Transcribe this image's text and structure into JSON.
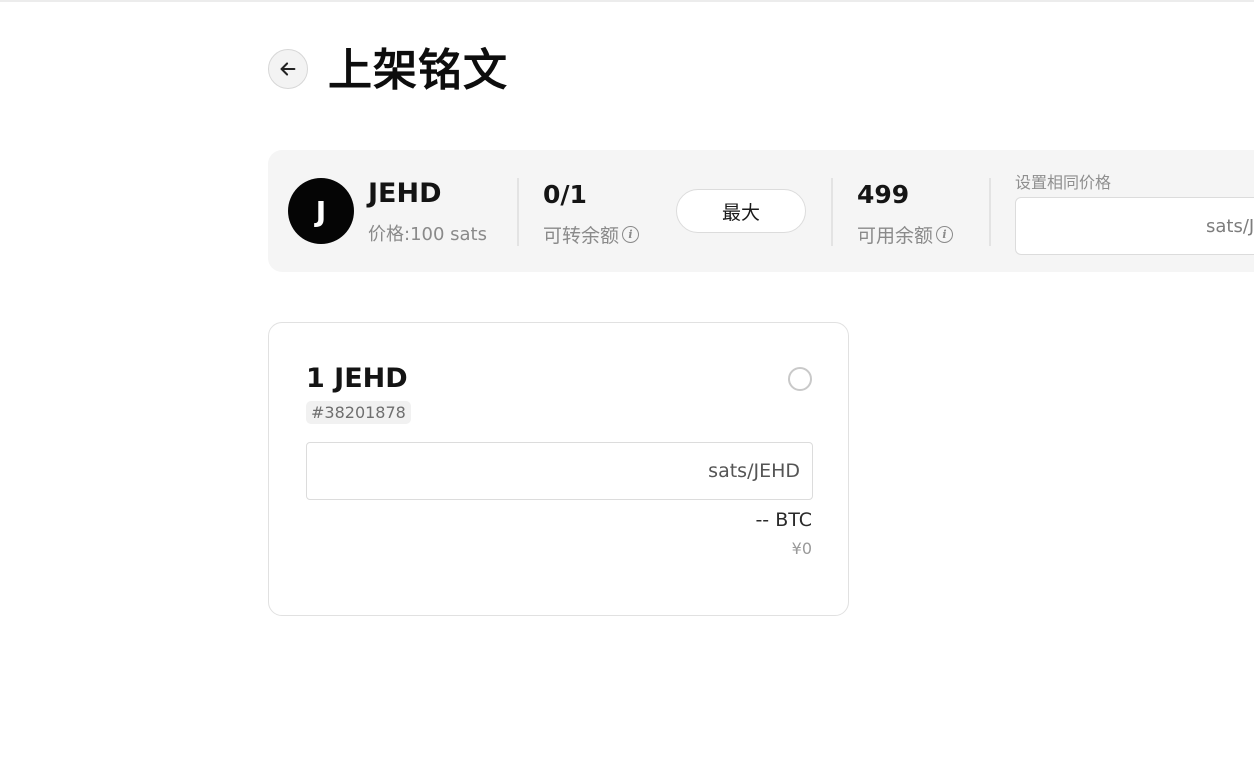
{
  "header": {
    "title": "上架铭文",
    "back_icon": "arrow-left-icon"
  },
  "summary": {
    "avatar_letter": "J",
    "token_name": "JEHD",
    "token_price": "价格:100 sats",
    "transferable": {
      "value": "0/1",
      "label": "可转余额"
    },
    "max_button_label": "最大",
    "available": {
      "value": "499",
      "label": "可用余额"
    },
    "same_price": {
      "label": "设置相同价格",
      "value": "",
      "unit": "sats/JEHD"
    },
    "info_icon": "info-icon"
  },
  "inscription_card": {
    "title": "1 JEHD",
    "number": "#38201878",
    "selected": false,
    "price_value": "",
    "price_unit": "sats/JEHD",
    "btc_amount": "-- BTC",
    "cny_amount": "¥0"
  }
}
